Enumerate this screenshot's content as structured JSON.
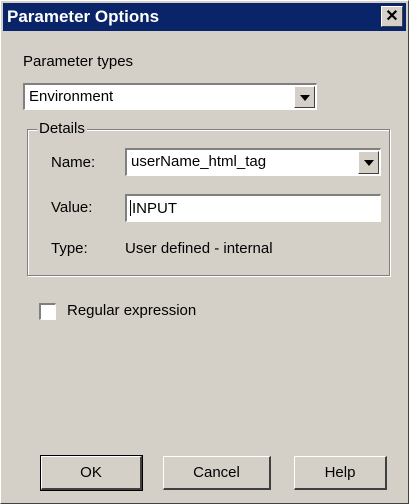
{
  "window": {
    "title": "Parameter Options",
    "close_symbol": "✕"
  },
  "parameter_types": {
    "label": "Parameter types",
    "selected": "Environment"
  },
  "details": {
    "legend": "Details",
    "name_label": "Name:",
    "name_value": "userName_html_tag",
    "value_label": "Value:",
    "value_value": "INPUT",
    "type_label": "Type:",
    "type_value": "User defined - internal"
  },
  "regular_expression": {
    "label": "Regular expression",
    "checked": false
  },
  "buttons": {
    "ok": "OK",
    "cancel": "Cancel",
    "help": "Help"
  },
  "icons": {
    "close": "close-icon",
    "dropdown": "chevron-down-icon"
  },
  "colors": {
    "titlebar": "#0a246a",
    "face": "#d4d0c8"
  }
}
